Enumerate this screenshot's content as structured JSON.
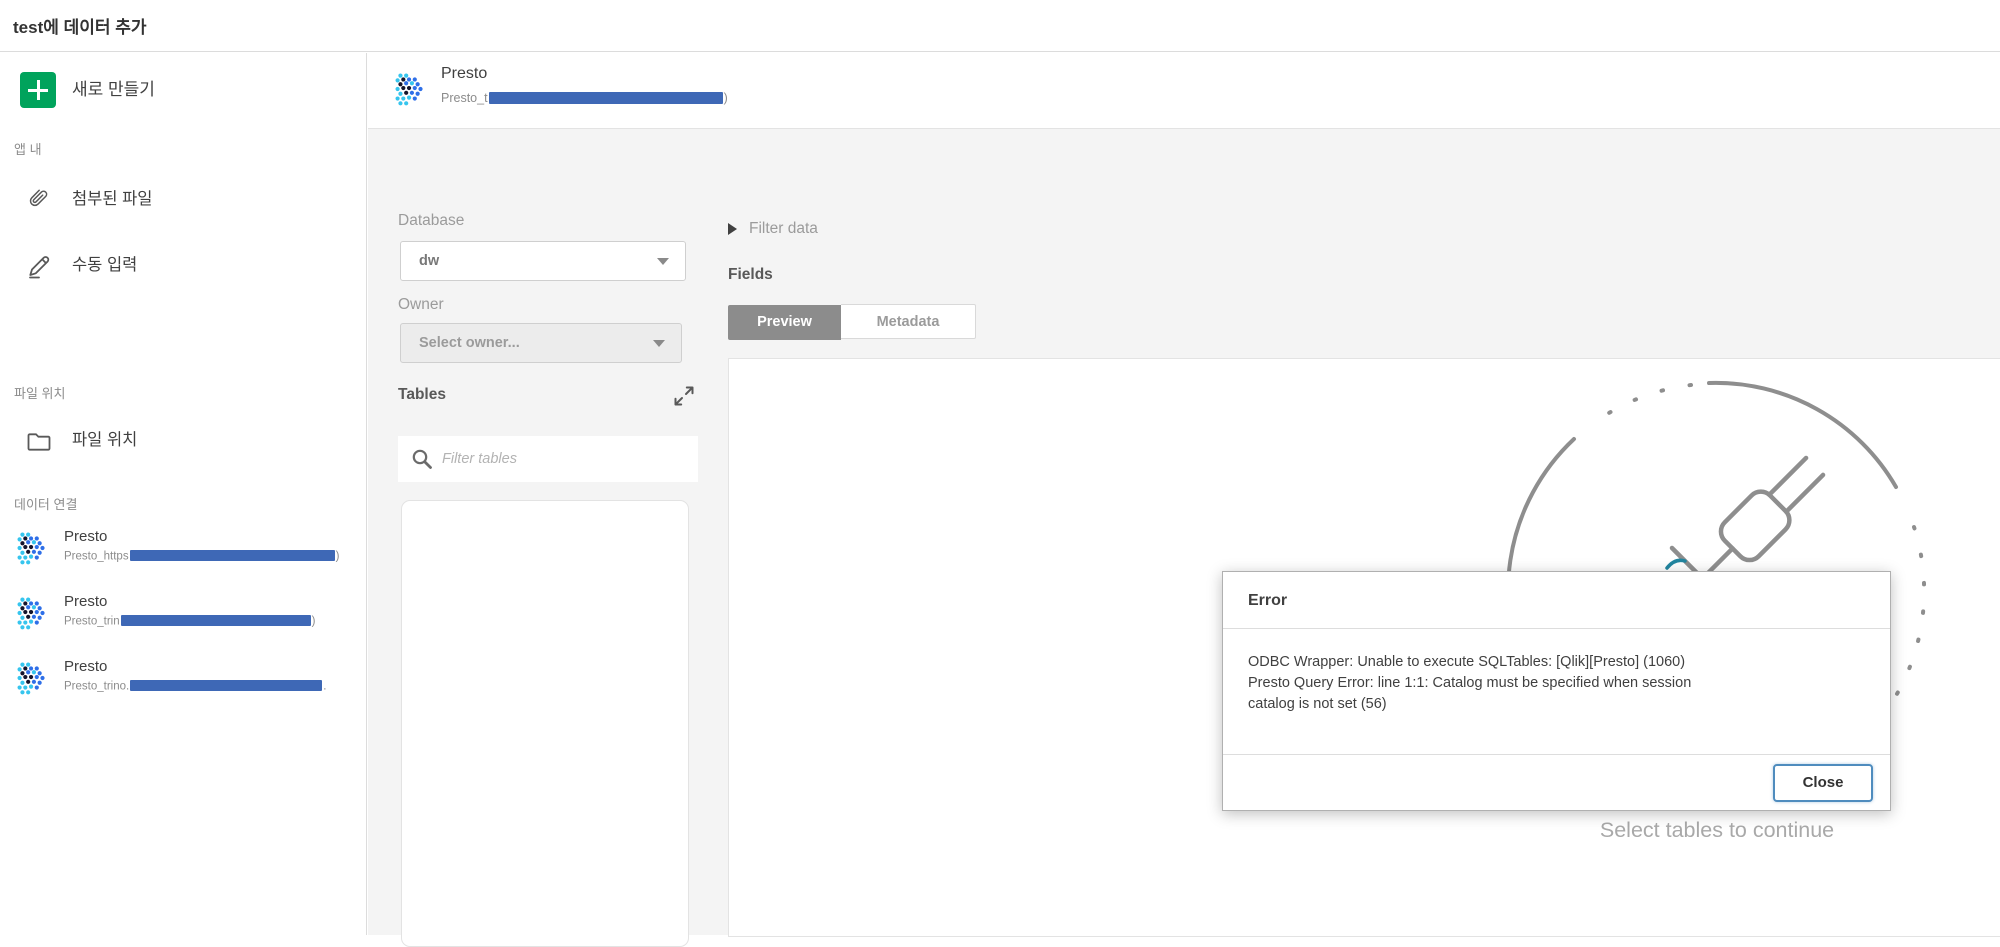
{
  "page": {
    "title": "test에 데이터 추가"
  },
  "sidebar": {
    "create_new": "새로 만들기",
    "section_in_app": "앱 내",
    "attached_files": "첨부된 파일",
    "manual_entry": "수동 입력",
    "section_file_locations": "파일 위치",
    "file_locations": "파일 위치",
    "section_data_connections": "데이터 연결",
    "connections": [
      {
        "name": "Presto",
        "sub_prefix": "Presto_https",
        "sub_suffix": ")"
      },
      {
        "name": "Presto",
        "sub_prefix": "Presto_trin",
        "sub_suffix": ")"
      },
      {
        "name": "Presto",
        "sub_prefix": "Presto_trino.",
        "sub_suffix": "."
      }
    ]
  },
  "header": {
    "title": "Presto",
    "sub_prefix": "Presto_t",
    "sub_suffix": ")"
  },
  "query_panel": {
    "database_label": "Database",
    "database_value": "dw",
    "owner_label": "Owner",
    "owner_value": "Select owner...",
    "tables_label": "Tables",
    "filter_placeholder": "Filter tables"
  },
  "fields_panel": {
    "filter_data_label": "Filter data",
    "fields_label": "Fields",
    "tabs": [
      {
        "label": "Preview",
        "active": true
      },
      {
        "label": "Metadata",
        "active": false
      }
    ],
    "empty_hint": "Select tables to continue"
  },
  "dialog": {
    "title": "Error",
    "message_lines": [
      "ODBC Wrapper: Unable to execute SQLTables: [Qlik][Presto] (1060)",
      "Presto Query Error: line 1:1: Catalog must be specified when session",
      "catalog is not set (56)"
    ],
    "close_label": "Close"
  },
  "colors": {
    "accent_green": "#00a35c",
    "redaction_blue": "#3e68b6",
    "close_button_border": "#4f8cbe",
    "tab_active_bg": "#8c8c8c",
    "content_background": "#f4f4f4",
    "illustration_stroke": "#8e8e8e",
    "illustration_accent_teal": "#2286a0"
  }
}
